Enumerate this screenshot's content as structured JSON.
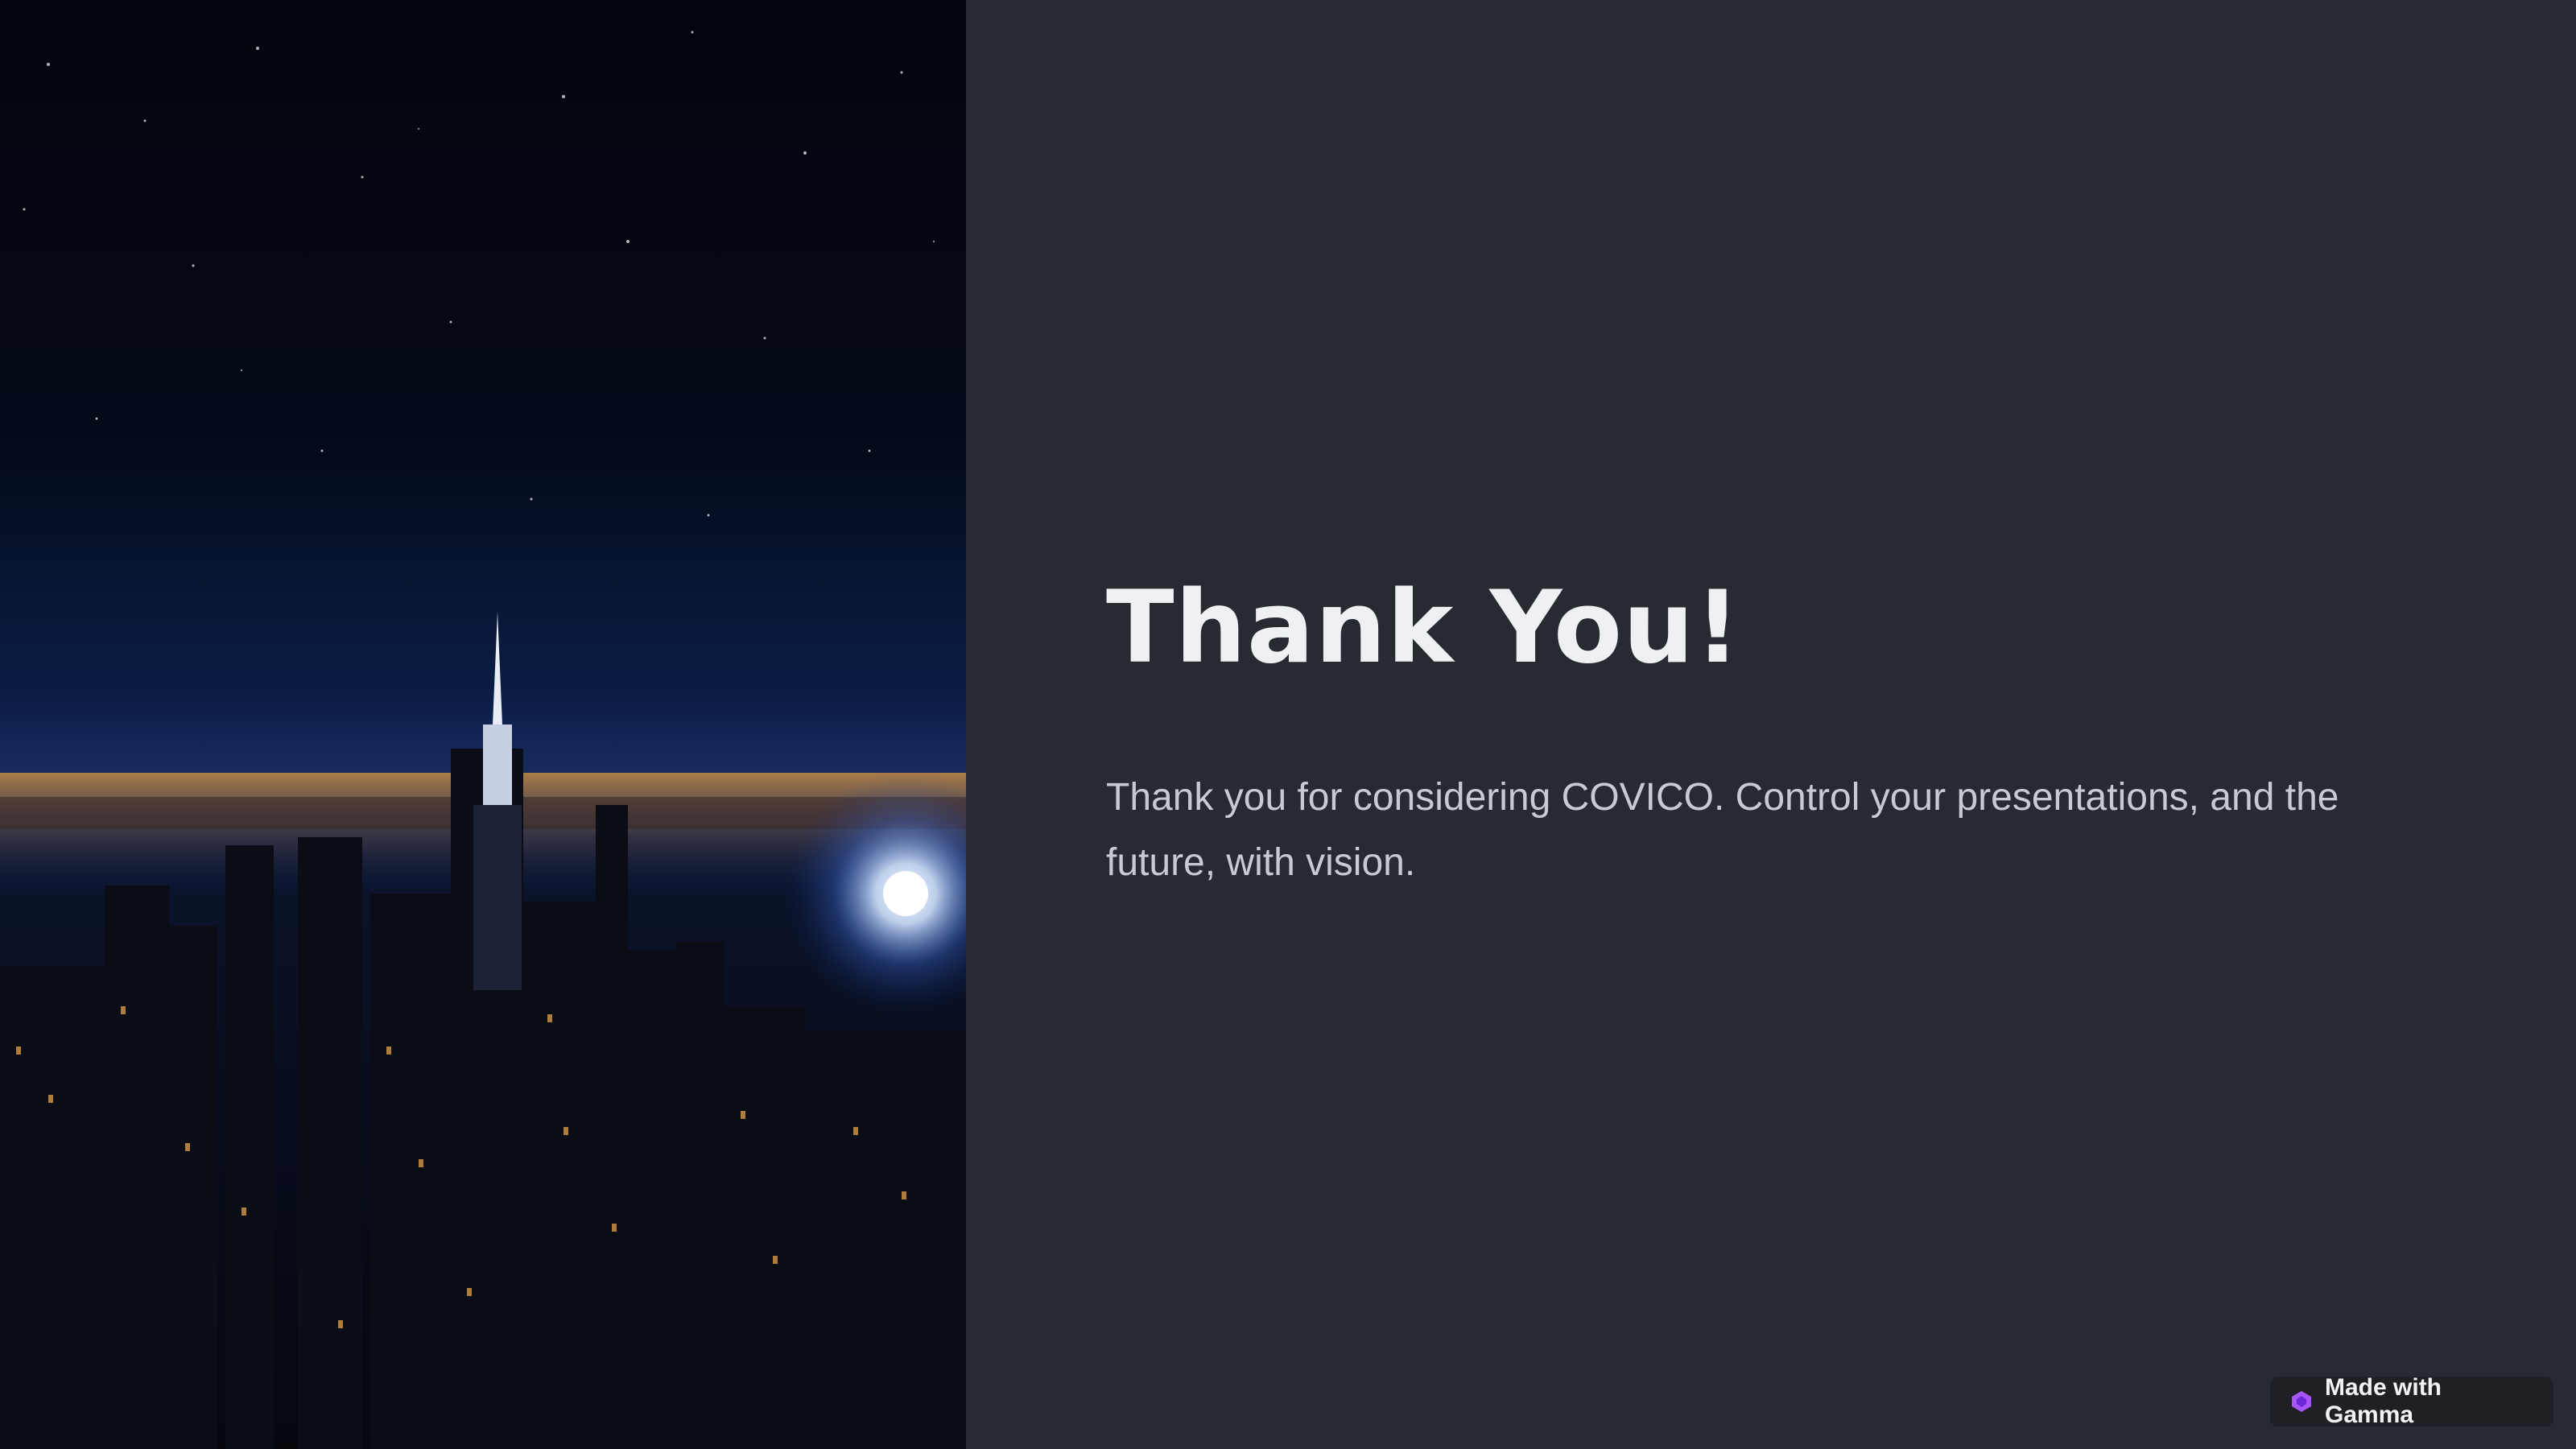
{
  "slide": {
    "image_description_icon": "night-city-skyline-image",
    "title": "Thank You!",
    "body": "Thank you for considering COVICO. Control your presentations, and the future, with vision."
  },
  "badge": {
    "icon": "gamma-logo-icon",
    "label": "Made with Gamma",
    "accent_colors": [
      "#a855f7",
      "#6d28d9"
    ]
  },
  "colors": {
    "background": "#282a31",
    "title": "#eef0f3",
    "body": "#c7cad1"
  }
}
